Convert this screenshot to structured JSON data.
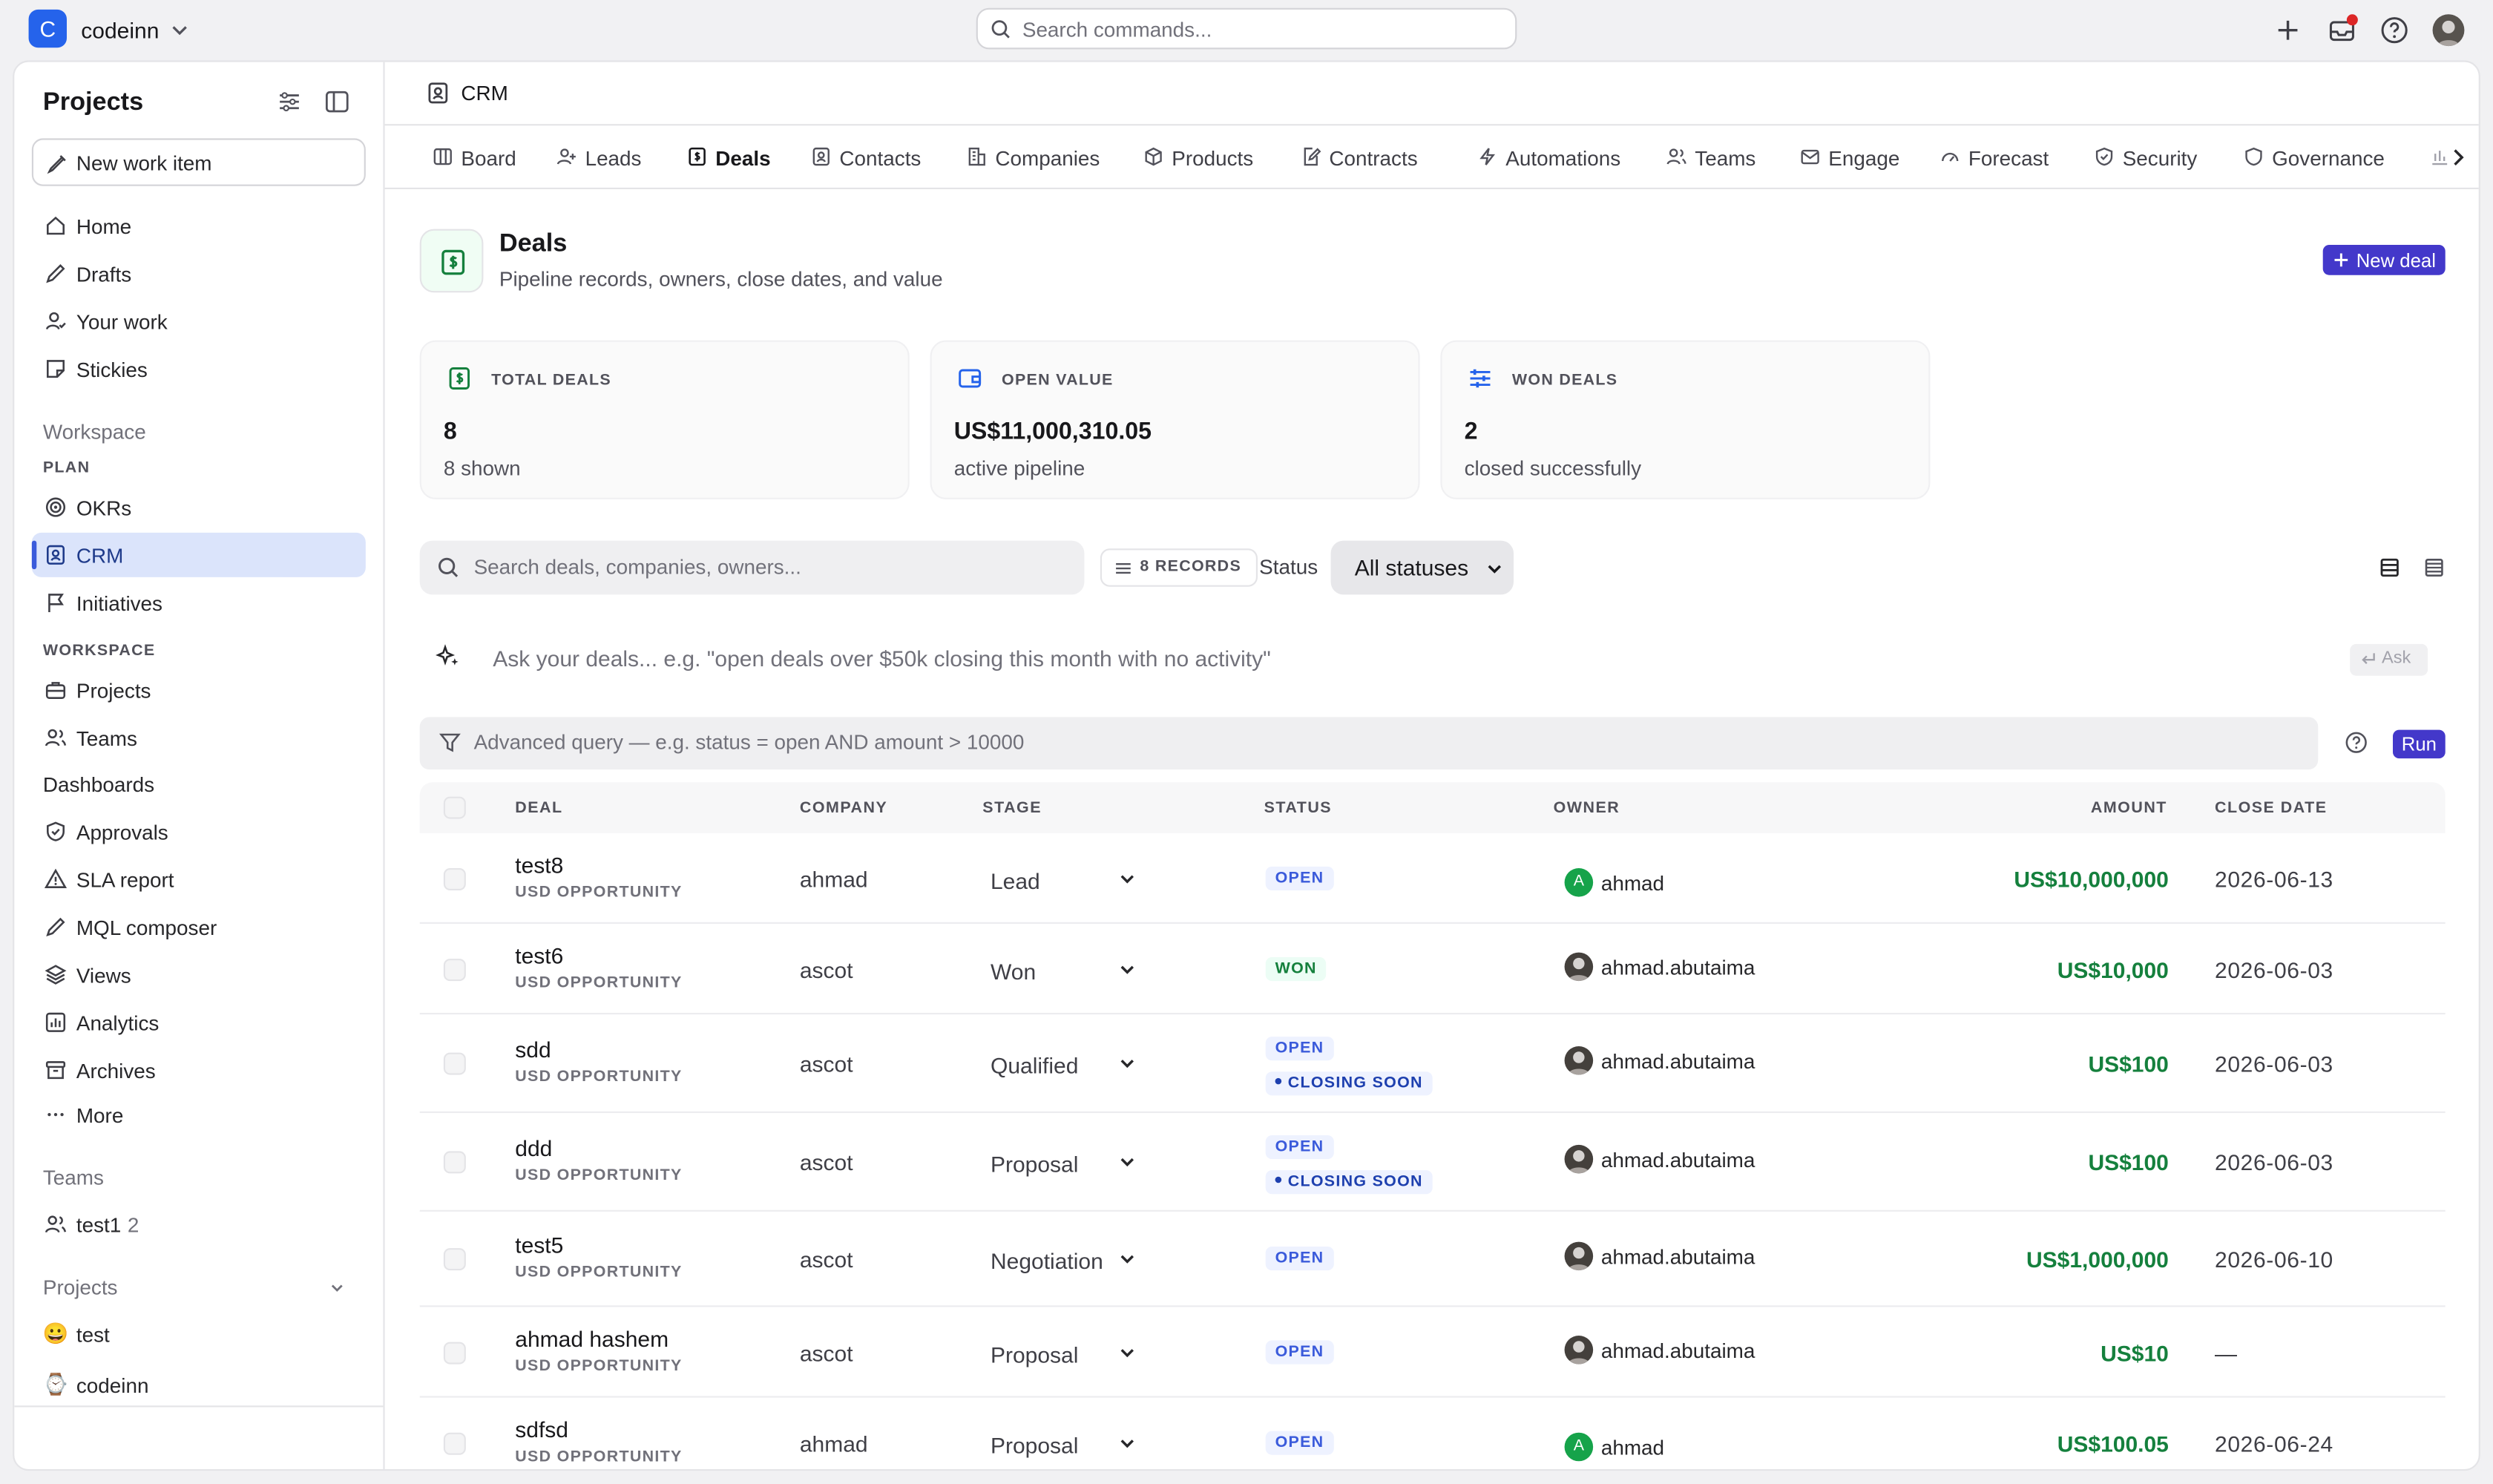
{
  "workspace": {
    "initial": "C",
    "name": "codeinn"
  },
  "command_search": {
    "placeholder": "Search commands..."
  },
  "sidebar": {
    "title": "Projects",
    "new_item": "New work item",
    "main_items": [
      "Home",
      "Drafts",
      "Your work",
      "Stickies"
    ],
    "workspace_heading": "Workspace",
    "plan_heading": "PLAN",
    "plan_items": [
      "OKRs",
      "CRM",
      "Initiatives"
    ],
    "workspace_sub_heading": "WORKSPACE",
    "workspace_items": [
      "Projects",
      "Teams"
    ],
    "dashboards_heading": "Dashboards",
    "dashboard_items": [
      "Approvals",
      "SLA report",
      "MQL composer",
      "Views",
      "Analytics",
      "Archives",
      "More"
    ],
    "teams_heading": "Teams",
    "team": {
      "name": "test1",
      "count": "2"
    },
    "projects_heading": "Projects",
    "projects": [
      {
        "emoji": "😀",
        "name": "test"
      },
      {
        "emoji": "⌚",
        "name": "codeinn"
      }
    ]
  },
  "breadcrumb": "CRM",
  "tabs": [
    "Board",
    "Leads",
    "Deals",
    "Contacts",
    "Companies",
    "Products",
    "Contracts",
    "Automations",
    "Teams",
    "Engage",
    "Forecast",
    "Security",
    "Governance"
  ],
  "active_tab": "Deals",
  "page": {
    "title": "Deals",
    "subtitle": "Pipeline records, owners, close dates, and value",
    "new_button": "New deal"
  },
  "kpis": [
    {
      "label": "TOTAL DEALS",
      "value": "8",
      "sub": "8 shown",
      "icon": "dollar-icon",
      "color": "#15803d"
    },
    {
      "label": "OPEN VALUE",
      "value": "US$11,000,310.05",
      "sub": "active pipeline",
      "icon": "wallet-icon",
      "color": "#2563eb"
    },
    {
      "label": "WON DEALS",
      "value": "2",
      "sub": "closed successfully",
      "icon": "sliders-icon",
      "color": "#2563eb"
    }
  ],
  "filters": {
    "search_placeholder": "Search deals, companies, owners...",
    "records": "8 RECORDS",
    "status_label": "Status",
    "status_value": "All statuses"
  },
  "ask": {
    "placeholder": "Ask your deals... e.g. \"open deals over $50k closing this month with no activity\"",
    "button": "Ask"
  },
  "advanced": {
    "placeholder": "Advanced query — e.g. status = open AND amount > 10000",
    "run": "Run"
  },
  "table": {
    "columns": [
      "DEAL",
      "COMPANY",
      "STAGE",
      "STATUS",
      "OWNER",
      "AMOUNT",
      "CLOSE DATE"
    ],
    "rows": [
      {
        "deal": "test8",
        "sub": "USD OPPORTUNITY",
        "company": "ahmad",
        "stage": "Lead",
        "status": [
          "OPEN"
        ],
        "owner": "ahmad",
        "owner_initial": "A",
        "amount": "US$10,000,000",
        "close": "2026-06-13"
      },
      {
        "deal": "test6",
        "sub": "USD OPPORTUNITY",
        "company": "ascot",
        "stage": "Won",
        "status": [
          "WON"
        ],
        "owner": "ahmad.abutaima",
        "owner_initial": "",
        "amount": "US$10,000",
        "close": "2026-06-03"
      },
      {
        "deal": "sdd",
        "sub": "USD OPPORTUNITY",
        "company": "ascot",
        "stage": "Qualified",
        "status": [
          "OPEN",
          "CLOSING SOON"
        ],
        "owner": "ahmad.abutaima",
        "owner_initial": "",
        "amount": "US$100",
        "close": "2026-06-03"
      },
      {
        "deal": "ddd",
        "sub": "USD OPPORTUNITY",
        "company": "ascot",
        "stage": "Proposal",
        "status": [
          "OPEN",
          "CLOSING SOON"
        ],
        "owner": "ahmad.abutaima",
        "owner_initial": "",
        "amount": "US$100",
        "close": "2026-06-03"
      },
      {
        "deal": "test5",
        "sub": "USD OPPORTUNITY",
        "company": "ascot",
        "stage": "Negotiation",
        "status": [
          "OPEN"
        ],
        "owner": "ahmad.abutaima",
        "owner_initial": "",
        "amount": "US$1,000,000",
        "close": "2026-06-10"
      },
      {
        "deal": "ahmad hashem",
        "sub": "USD OPPORTUNITY",
        "company": "ascot",
        "stage": "Proposal",
        "status": [
          "OPEN"
        ],
        "owner": "ahmad.abutaima",
        "owner_initial": "",
        "amount": "US$10",
        "close": "—"
      },
      {
        "deal": "sdfsd",
        "sub": "USD OPPORTUNITY",
        "company": "ahmad",
        "stage": "Proposal",
        "status": [
          "OPEN"
        ],
        "owner": "ahmad",
        "owner_initial": "A",
        "amount": "US$100.05",
        "close": "2026-06-24"
      }
    ]
  },
  "colors": {
    "accent": "#4338ca",
    "money": "#15803d",
    "open": "#3b5bdb",
    "active_nav": "#dbe4fb"
  }
}
